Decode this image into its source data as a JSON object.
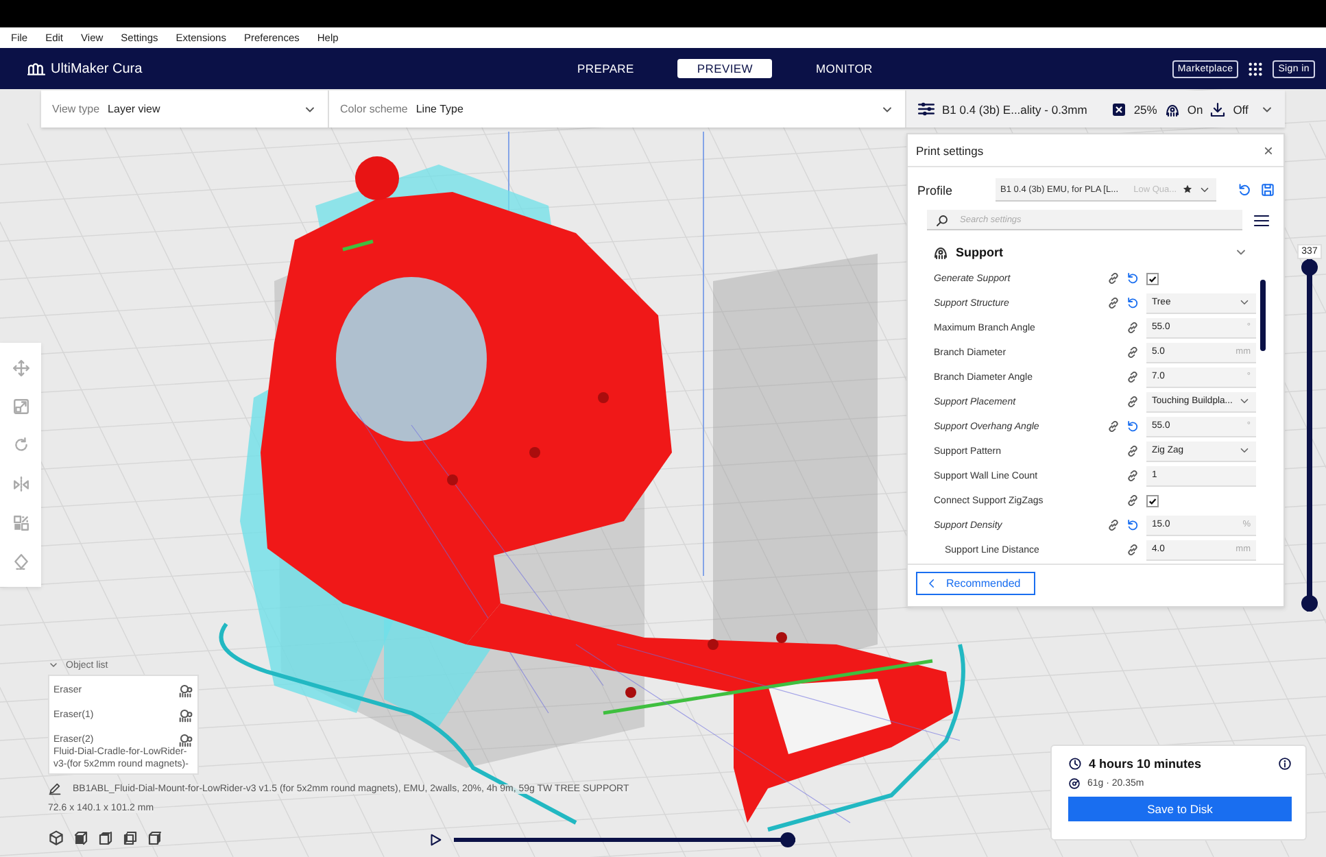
{
  "menu": [
    "File",
    "Edit",
    "View",
    "Settings",
    "Extensions",
    "Preferences",
    "Help"
  ],
  "header": {
    "logo": "UltiMaker Cura",
    "tabs": [
      {
        "label": "PREPARE",
        "selected": false
      },
      {
        "label": "PREVIEW",
        "selected": true
      },
      {
        "label": "MONITOR",
        "selected": false
      }
    ],
    "marketplace": "Marketplace",
    "sign_in": "Sign in"
  },
  "view_bar": {
    "view_type": {
      "label": "View type",
      "value": "Layer view"
    },
    "color_scheme": {
      "label": "Color scheme",
      "value": "Line Type"
    },
    "print_setup": {
      "profile": "B1 0.4 (3b) E...ality - 0.3mm",
      "infill": "25%",
      "support": "On",
      "adhesion": "Off"
    }
  },
  "print_settings": {
    "title": "Print settings",
    "profile": {
      "label": "Profile",
      "name": "B1 0.4 (3b) EMU, for PLA [L...",
      "quality": "Low Qua..."
    },
    "search": {
      "placeholder": "Search settings"
    },
    "category": {
      "title": "Support",
      "expanded": true
    },
    "settings": [
      {
        "label": "Generate Support",
        "modified": true,
        "resettable": true,
        "kind": "checkbox",
        "checked": true
      },
      {
        "label": "Support Structure",
        "modified": true,
        "resettable": true,
        "kind": "select",
        "value": "Tree"
      },
      {
        "label": "Maximum Branch Angle",
        "modified": false,
        "resettable": false,
        "kind": "number",
        "value": "55.0",
        "unit": "°"
      },
      {
        "label": "Branch Diameter",
        "modified": false,
        "resettable": false,
        "kind": "number",
        "value": "5.0",
        "unit": "mm"
      },
      {
        "label": "Branch Diameter Angle",
        "modified": false,
        "resettable": false,
        "kind": "number",
        "value": "7.0",
        "unit": "°"
      },
      {
        "label": "Support Placement",
        "modified": true,
        "resettable": false,
        "kind": "select",
        "value": "Touching Buildpla..."
      },
      {
        "label": "Support Overhang Angle",
        "modified": true,
        "resettable": true,
        "kind": "number",
        "value": "55.0",
        "unit": "°"
      },
      {
        "label": "Support Pattern",
        "modified": false,
        "resettable": false,
        "kind": "select",
        "value": "Zig Zag"
      },
      {
        "label": "Support Wall Line Count",
        "modified": false,
        "resettable": false,
        "kind": "number",
        "value": "1"
      },
      {
        "label": "Connect Support ZigZags",
        "modified": false,
        "resettable": false,
        "kind": "checkbox",
        "checked": true
      },
      {
        "label": "Support Density",
        "modified": true,
        "resettable": true,
        "kind": "number",
        "value": "15.0",
        "unit": "%",
        "children": [
          {
            "label": "Support Line Distance",
            "modified": false,
            "resettable": false,
            "kind": "number",
            "value": "4.0",
            "unit": "mm"
          }
        ]
      }
    ],
    "mode_button": "Recommended"
  },
  "layer_slider": {
    "value": "337",
    "upper": {
      "level": 1
    },
    "lower": {
      "level": 0
    }
  },
  "object_list": {
    "title": "Object list",
    "expanded": true,
    "items": [
      {
        "name": "Eraser",
        "kind": "eraser"
      },
      {
        "name": "Eraser(1)",
        "kind": "eraser"
      },
      {
        "name": "Eraser(2)",
        "kind": "eraser"
      },
      {
        "name": "Fluid-Dial-Cradle-for-LowRider-v3-(for 5x2mm round magnets)-",
        "kind": "model"
      }
    ]
  },
  "job": {
    "name": "BB1ABL_Fluid-Dial-Mount-for-LowRider-v3 v1.5 (for 5x2mm round magnets), EMU, 2walls, 20%, 4h 9m, 59g TW TREE SUPPORT",
    "dimensions": "72.6 x 140.1 x 101.2 mm"
  },
  "playback": {
    "level": 1
  },
  "summary": {
    "time": "4 hours 10 minutes",
    "material": "61g · 20.35m",
    "save_button": "Save to Disk"
  }
}
